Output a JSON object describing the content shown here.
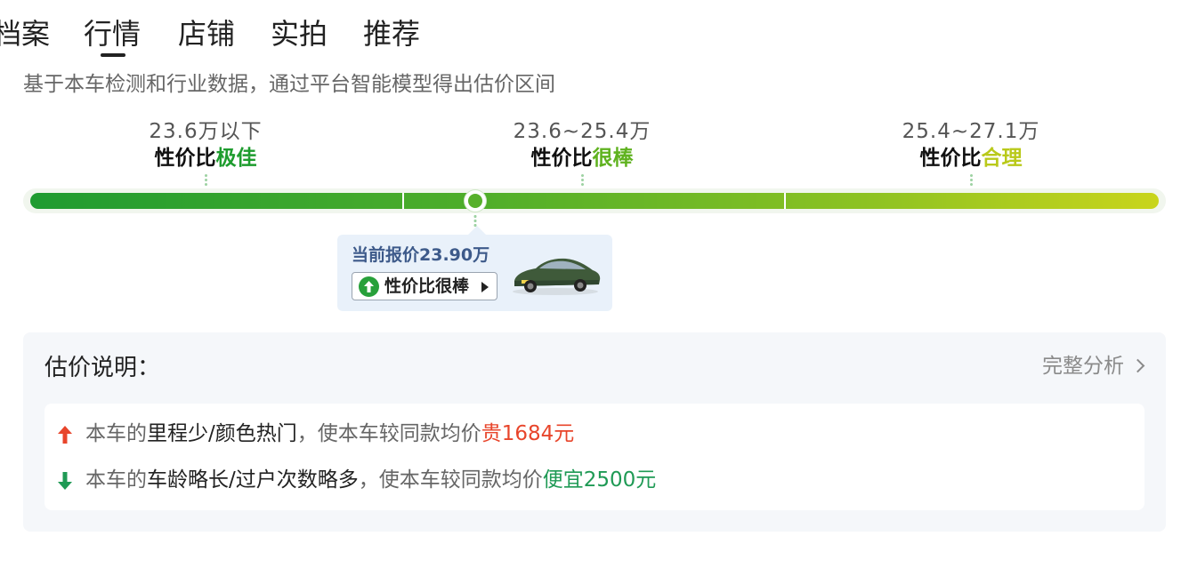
{
  "tabs": [
    {
      "label": "档案"
    },
    {
      "label": "行情"
    },
    {
      "label": "店铺"
    },
    {
      "label": "实拍"
    },
    {
      "label": "推荐"
    }
  ],
  "active_tab": "行情",
  "description": "基于本车检测和行业数据，通过平台智能模型得出估价区间",
  "ranges": [
    {
      "price": "23.6万以下",
      "tag_prefix": "性价比",
      "tag_level": "极佳",
      "color": "#1e9c2e"
    },
    {
      "price": "23.6~25.4万",
      "tag_prefix": "性价比",
      "tag_level": "很棒",
      "color": "#5fb21f"
    },
    {
      "price": "25.4~27.1万",
      "tag_prefix": "性价比",
      "tag_level": "合理",
      "color": "#b9c91a"
    }
  ],
  "current_quote": {
    "label": "当前报价23.90万",
    "badge": "性价比很棒",
    "position_in_scale": 0.39
  },
  "explanation": {
    "title": "估价说明：",
    "full_analysis": "完整分析",
    "reasons": [
      {
        "direction": "up",
        "prefix": "本车的",
        "factors": "里程少/颜色热门",
        "middle": "，使本车较同款均价",
        "effect": "贵1684元",
        "color": "#e8452b"
      },
      {
        "direction": "down",
        "prefix": "本车的",
        "factors": "车龄略长/过户次数略多",
        "middle": "，使本车较同款均价",
        "effect": "便宜2500元",
        "color": "#1f9a55"
      }
    ]
  }
}
